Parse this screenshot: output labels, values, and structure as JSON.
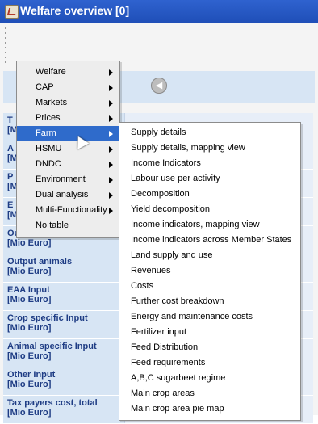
{
  "window": {
    "title": "Welfare overview [0]"
  },
  "rows": [
    {
      "label": "T\n[M"
    },
    {
      "label": "A\n[M"
    },
    {
      "label": "P\n[M"
    },
    {
      "label": "E\n[Mio Euro]"
    },
    {
      "label": "Output crops\n[Mio Euro]"
    },
    {
      "label": "Output animals\n[Mio Euro]"
    },
    {
      "label": "EAA Input\n[Mio Euro]"
    },
    {
      "label": "Crop specific Input\n[Mio Euro]"
    },
    {
      "label": "Animal specific Input\n[Mio Euro]"
    },
    {
      "label": "Other Input\n[Mio Euro]"
    },
    {
      "label": "Tax payers cost, total\n[Mio Euro]"
    }
  ],
  "menu": {
    "items": [
      {
        "label": "Welfare"
      },
      {
        "label": "CAP"
      },
      {
        "label": "Markets"
      },
      {
        "label": "Prices"
      },
      {
        "label": "Farm"
      },
      {
        "label": "HSMU"
      },
      {
        "label": "DNDC"
      },
      {
        "label": "Environment"
      },
      {
        "label": "Dual analysis"
      },
      {
        "label": "Multi-Functionality"
      },
      {
        "label": "No table"
      }
    ]
  },
  "submenu": {
    "items": [
      {
        "label": "Supply details"
      },
      {
        "label": "Supply details, mapping view"
      },
      {
        "label": "Income Indicators"
      },
      {
        "label": "Labour use per activity"
      },
      {
        "label": "Decomposition"
      },
      {
        "label": "Yield decomposition"
      },
      {
        "label": "Income indicators, mapping view"
      },
      {
        "label": "Income indicators across Member States"
      },
      {
        "label": "Land supply and use"
      },
      {
        "label": "Revenues"
      },
      {
        "label": "Costs"
      },
      {
        "label": "Further cost breakdown"
      },
      {
        "label": "Energy and maintenance costs"
      },
      {
        "label": "Fertilizer input"
      },
      {
        "label": "Feed Distribution"
      },
      {
        "label": "Feed requirements"
      },
      {
        "label": "A,B,C sugarbeet regime"
      },
      {
        "label": "Main crop areas"
      },
      {
        "label": "Main crop area pie map"
      }
    ]
  }
}
